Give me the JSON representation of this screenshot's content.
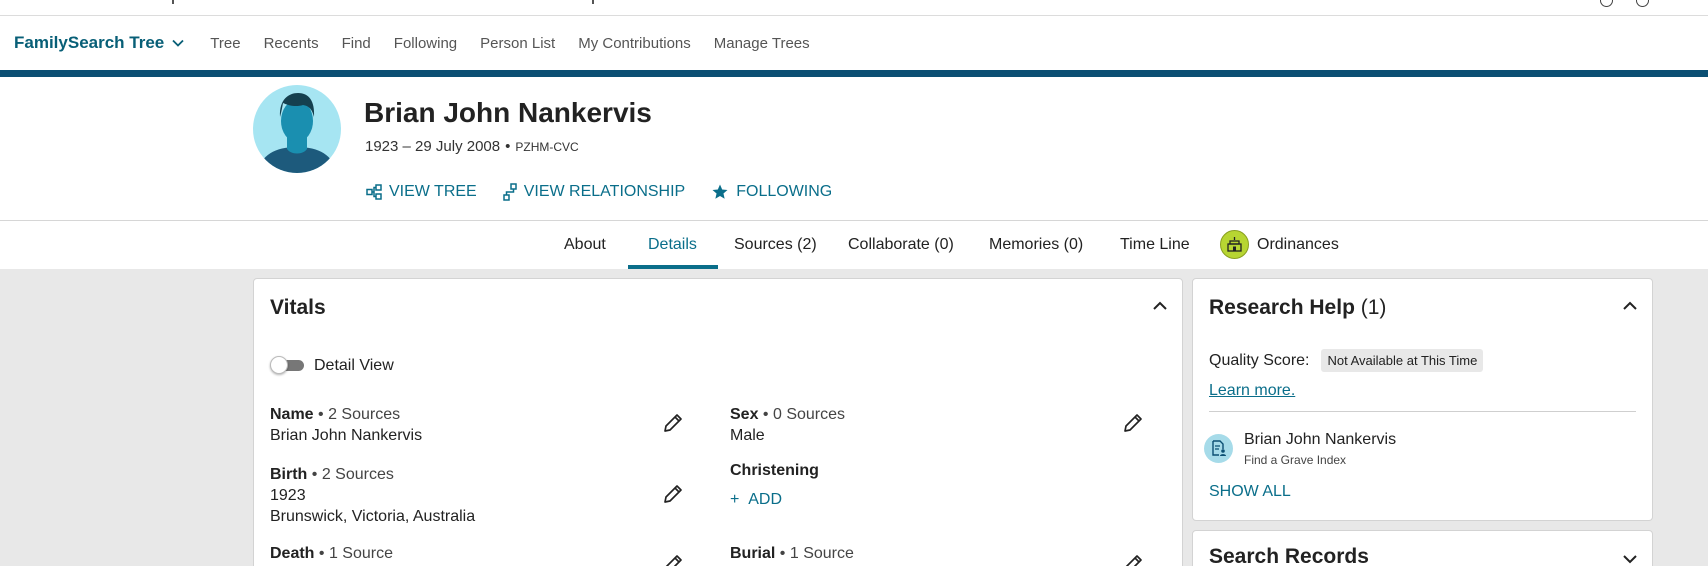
{
  "nav": {
    "brand": "FamilySearch Tree",
    "links": [
      "Tree",
      "Recents",
      "Find",
      "Following",
      "Person List",
      "My Contributions",
      "Manage Trees"
    ]
  },
  "person": {
    "name": "Brian John Nankervis",
    "dates": "1923 – 29 July 2008",
    "separator": "•",
    "pid": "PZHM-CVC",
    "actions": {
      "view_tree": "VIEW TREE",
      "view_relationship": "VIEW RELATIONSHIP",
      "following": "FOLLOWING"
    }
  },
  "tabs": {
    "about": "About",
    "details": "Details",
    "sources": "Sources (2)",
    "collaborate": "Collaborate (0)",
    "memories": "Memories (0)",
    "timeline": "Time Line",
    "ordinances": "Ordinances",
    "active": "Details"
  },
  "vitals": {
    "title": "Vitals",
    "detail_view_label": "Detail View",
    "detail_view_on": false,
    "name": {
      "label": "Name",
      "sources": "• 2 Sources",
      "value": "Brian John Nankervis"
    },
    "sex": {
      "label": "Sex",
      "sources": "• 0 Sources",
      "value": "Male"
    },
    "birth": {
      "label": "Birth",
      "sources": "• 2 Sources",
      "date": "1923",
      "place": "Brunswick, Victoria, Australia"
    },
    "christening": {
      "label": "Christening",
      "add": "ADD"
    },
    "death": {
      "label": "Death",
      "sources": "• 1 Source"
    },
    "burial": {
      "label": "Burial",
      "sources": "• 1 Source"
    }
  },
  "research_help": {
    "title": "Research Help",
    "count": "(1)",
    "quality_label": "Quality Score:",
    "quality_value": "Not Available at This Time",
    "learn_more": "Learn more.",
    "record_name": "Brian John Nankervis",
    "record_source": "Find a Grave Index",
    "show_all": "SHOW ALL"
  },
  "search_records": {
    "title": "Search Records"
  },
  "colors": {
    "brand": "#085f77",
    "link": "#0a6e8a",
    "header_bar": "#0b4f73",
    "avatar_bg": "#a6e5f2",
    "ordinance_badge": "#b7d532",
    "page_bg": "#e8e8e8"
  }
}
